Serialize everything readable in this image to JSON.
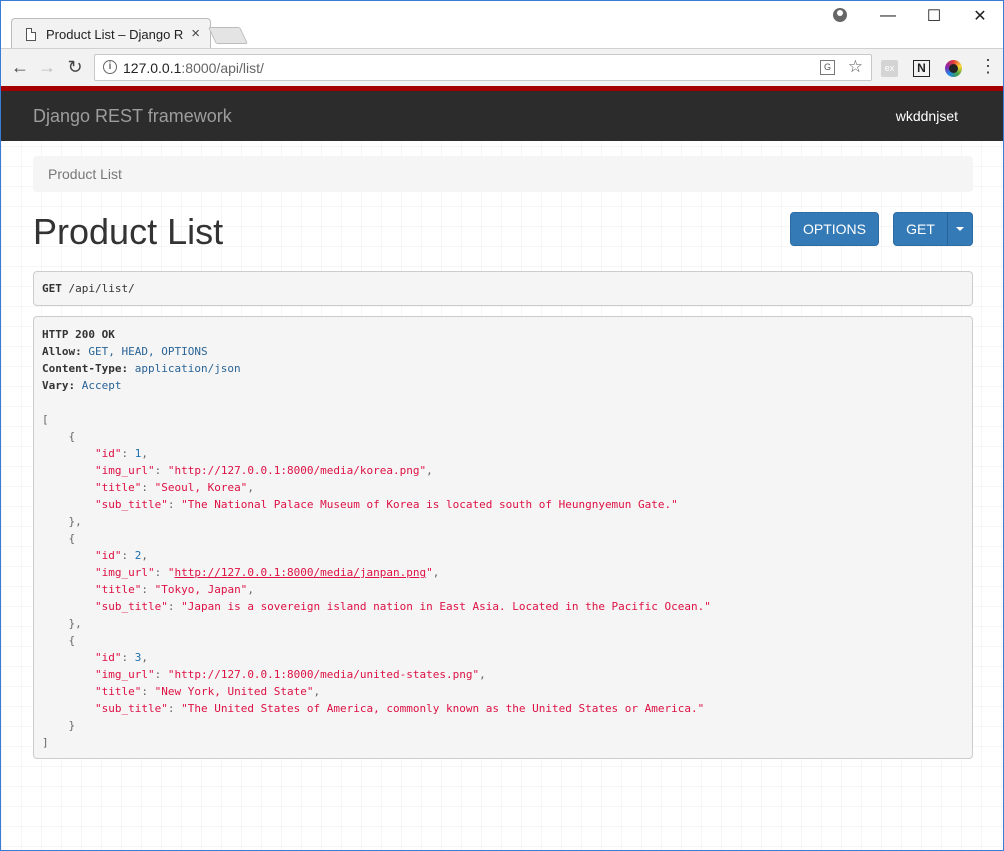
{
  "browser": {
    "tab_title": "Product List – Django R",
    "url_host": "127.0.0.1",
    "url_rest": ":8000/api/list/",
    "ext_ex_label": "ex",
    "ext_n_label": "N"
  },
  "navbar": {
    "brand": "Django REST framework",
    "user": "wkddnjset"
  },
  "breadcrumb": "Product List",
  "title": "Product List",
  "buttons": {
    "options": "OPTIONS",
    "get": "GET"
  },
  "request": {
    "method": "GET",
    "path": "/api/list/"
  },
  "response": {
    "status": "HTTP 200 OK",
    "headers": [
      {
        "name": "Allow:",
        "value": "GET, HEAD, OPTIONS"
      },
      {
        "name": "Content-Type:",
        "value": "application/json"
      },
      {
        "name": "Vary:",
        "value": "Accept"
      }
    ],
    "items": [
      {
        "id": "1",
        "img_url": "\"http://127.0.0.1:8000/media/korea.png\"",
        "title": "\"Seoul, Korea\"",
        "sub_title": "\"The National Palace Museum of Korea is located south of Heungnyemun Gate.\""
      },
      {
        "id": "2",
        "img_url_link": "http://127.0.0.1:8000/media/janpan.png",
        "title": "\"Tokyo, Japan\"",
        "sub_title": "\"Japan is a sovereign island nation in East Asia. Located in the Pacific Ocean.\""
      },
      {
        "id": "3",
        "img_url": "\"http://127.0.0.1:8000/media/united-states.png\"",
        "title": "\"New York, United State\"",
        "sub_title": "\"The United States of America, commonly known as the United States or America.\""
      }
    ]
  }
}
